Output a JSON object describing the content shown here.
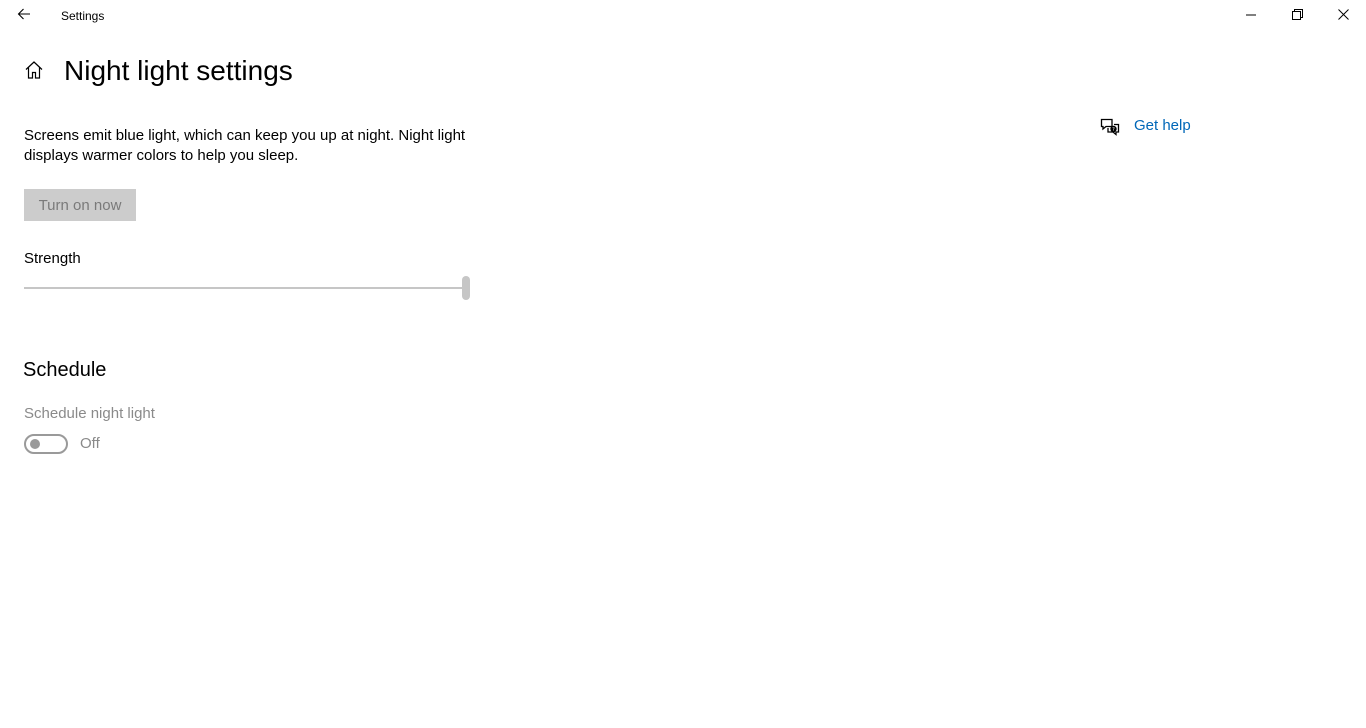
{
  "window": {
    "title": "Settings",
    "back_icon": "back-arrow-icon",
    "minimize_icon": "minimize-icon",
    "maximize_icon": "restore-icon",
    "close_icon": "close-icon"
  },
  "header": {
    "home_icon": "home-icon",
    "title": "Night light settings"
  },
  "content": {
    "description": "Screens emit blue light, which can keep you up at night. Night light displays warmer colors to help you sleep.",
    "turn_on_button": "Turn on now",
    "strength": {
      "label": "Strength",
      "value_fraction": 1.0
    },
    "schedule": {
      "heading": "Schedule",
      "toggle_label": "Schedule night light",
      "toggle_state": "Off",
      "toggle_on": false
    }
  },
  "help": {
    "icon": "chat-help-icon",
    "label": "Get help",
    "link_color": "#0067b8"
  },
  "colors": {
    "disabled_button_bg": "#cccccc",
    "disabled_text": "#8a8a8a",
    "slider_gray": "#c6c6c6"
  }
}
